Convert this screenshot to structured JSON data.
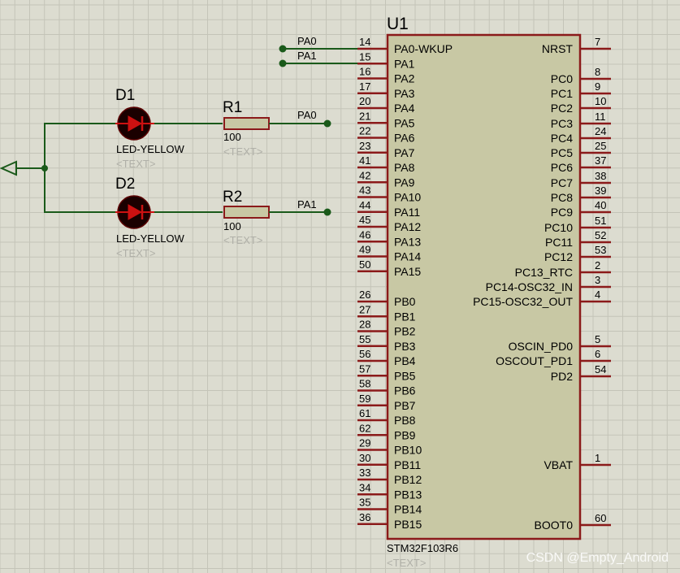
{
  "chip": {
    "ref": "U1",
    "part": "STM32F103R6",
    "text_placeholder": "<TEXT>",
    "left_pins": [
      {
        "num": "14",
        "name": "PA0-WKUP"
      },
      {
        "num": "15",
        "name": "PA1"
      },
      {
        "num": "16",
        "name": "PA2"
      },
      {
        "num": "17",
        "name": "PA3"
      },
      {
        "num": "20",
        "name": "PA4"
      },
      {
        "num": "21",
        "name": "PA5"
      },
      {
        "num": "22",
        "name": "PA6"
      },
      {
        "num": "23",
        "name": "PA7"
      },
      {
        "num": "41",
        "name": "PA8"
      },
      {
        "num": "42",
        "name": "PA9"
      },
      {
        "num": "43",
        "name": "PA10"
      },
      {
        "num": "44",
        "name": "PA11"
      },
      {
        "num": "45",
        "name": "PA12"
      },
      {
        "num": "46",
        "name": "PA13"
      },
      {
        "num": "49",
        "name": "PA14"
      },
      {
        "num": "50",
        "name": "PA15"
      },
      {
        "num": "26",
        "name": "PB0"
      },
      {
        "num": "27",
        "name": "PB1"
      },
      {
        "num": "28",
        "name": "PB2"
      },
      {
        "num": "55",
        "name": "PB3"
      },
      {
        "num": "56",
        "name": "PB4"
      },
      {
        "num": "57",
        "name": "PB5"
      },
      {
        "num": "58",
        "name": "PB6"
      },
      {
        "num": "59",
        "name": "PB7"
      },
      {
        "num": "61",
        "name": "PB8"
      },
      {
        "num": "62",
        "name": "PB9"
      },
      {
        "num": "29",
        "name": "PB10"
      },
      {
        "num": "30",
        "name": "PB11"
      },
      {
        "num": "33",
        "name": "PB12"
      },
      {
        "num": "34",
        "name": "PB13"
      },
      {
        "num": "35",
        "name": "PB14"
      },
      {
        "num": "36",
        "name": "PB15"
      }
    ],
    "right_pins": [
      {
        "num": "7",
        "name": "NRST"
      },
      {
        "num": "8",
        "name": "PC0"
      },
      {
        "num": "9",
        "name": "PC1"
      },
      {
        "num": "10",
        "name": "PC2"
      },
      {
        "num": "11",
        "name": "PC3"
      },
      {
        "num": "24",
        "name": "PC4"
      },
      {
        "num": "25",
        "name": "PC5"
      },
      {
        "num": "37",
        "name": "PC6"
      },
      {
        "num": "38",
        "name": "PC7"
      },
      {
        "num": "39",
        "name": "PC8"
      },
      {
        "num": "40",
        "name": "PC9"
      },
      {
        "num": "51",
        "name": "PC10"
      },
      {
        "num": "52",
        "name": "PC11"
      },
      {
        "num": "53",
        "name": "PC12"
      },
      {
        "num": "2",
        "name": "PC13_RTC"
      },
      {
        "num": "3",
        "name": "PC14-OSC32_IN"
      },
      {
        "num": "4",
        "name": "PC15-OSC32_OUT"
      },
      {
        "num": "5",
        "name": "OSCIN_PD0"
      },
      {
        "num": "6",
        "name": "OSCOUT_PD1"
      },
      {
        "num": "54",
        "name": "PD2"
      },
      {
        "num": "1",
        "name": "VBAT"
      },
      {
        "num": "60",
        "name": "BOOT0"
      }
    ]
  },
  "nets": {
    "pa0": "PA0",
    "pa1": "PA1"
  },
  "d1": {
    "ref": "D1",
    "value": "LED-YELLOW",
    "text": "<TEXT>"
  },
  "d2": {
    "ref": "D2",
    "value": "LED-YELLOW",
    "text": "<TEXT>"
  },
  "r1": {
    "ref": "R1",
    "value": "100",
    "text": "<TEXT>"
  },
  "r2": {
    "ref": "R2",
    "value": "100",
    "text": "<TEXT>"
  },
  "watermark": "CSDN @Empty_Android",
  "colors": {
    "background": "#dcdcd0",
    "grid": "#c4c4b8",
    "body_fill": "#c8c8a4",
    "body_stroke": "#8b1a1a",
    "wire": "#1a5a1a",
    "pin": "#8b1a1a"
  }
}
